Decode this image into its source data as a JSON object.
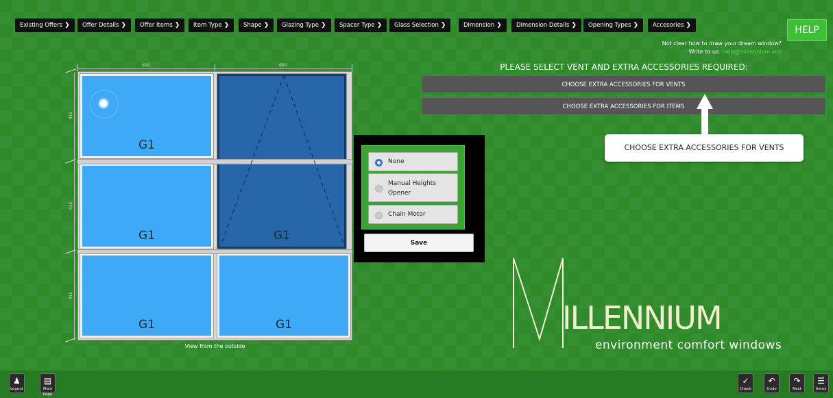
{
  "nav": {
    "items": [
      {
        "label": "Existing Offers"
      },
      {
        "label": "Offer Details"
      },
      {
        "label": "Offer Items"
      },
      {
        "label": "Item Type"
      },
      {
        "label": "Shape"
      },
      {
        "label": "Glazing Type"
      },
      {
        "label": "Spacer Type"
      },
      {
        "label": "Glass Selection"
      },
      {
        "label": "Dimension"
      },
      {
        "label": "Dimension Details"
      },
      {
        "label": "Opening Types"
      },
      {
        "label": "Accesories"
      }
    ],
    "chevron": "❯"
  },
  "help": {
    "button": "HELP",
    "line1": "Not clear how to draw your dream window?",
    "line2_prefix": "Write to us:",
    "email": "help@millennium.eco"
  },
  "accessories": {
    "title": "PLEASE SELECT VENT AND EXTRA ACCESSORIES REQUIRED:",
    "vents_button": "CHOOSE EXTRA ACCESSORIES FOR VENTS",
    "items_button": "CHOOSE EXTRA ACCESSORIES FOR ITEMS",
    "callout": "CHOOSE EXTRA ACCESSORIES FOR VENTS"
  },
  "drawing": {
    "width_left": "600",
    "width_right": "600",
    "height_top": "415",
    "height_mid": "415",
    "height_bot": "415",
    "panes": [
      "G1",
      "G1",
      "G1",
      "G1",
      "G1",
      "G1"
    ],
    "view_label": "View from the outside"
  },
  "opener": {
    "options": [
      {
        "label": "None",
        "selected": true
      },
      {
        "label": "Manual Heights Opener",
        "selected": false
      },
      {
        "label": "Chain Motor",
        "selected": false
      }
    ],
    "save": "Save"
  },
  "logo": {
    "name": "ILLENNIUM",
    "tagline": "environment comfort windows"
  },
  "bottom": {
    "logout": "Logout",
    "main_page": "Main Page",
    "check": "Check",
    "undo": "Undo",
    "next": "Next",
    "items": "Items"
  },
  "colors": {
    "background": "#2f8a2a",
    "pane": "#3ea9f7",
    "pane_selected": "#2666a8",
    "help_button": "#3fbf38",
    "accent_email": "#5fd85a"
  }
}
